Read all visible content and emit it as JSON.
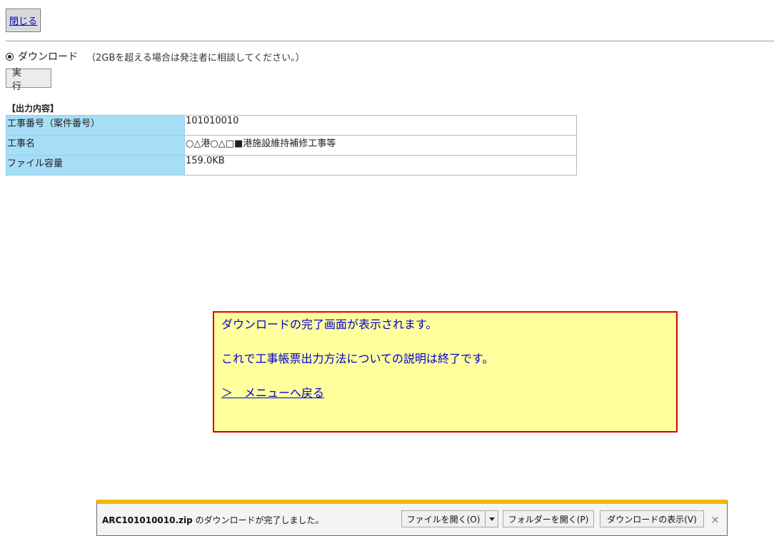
{
  "toolbar": {
    "close_label": "閉じる"
  },
  "download_option": {
    "label": "ダウンロード",
    "note": "（2GBを超える場合は発注者に相談してください。）",
    "execute_label": "実　行"
  },
  "output": {
    "title": "【出力内容】",
    "rows": [
      {
        "label": "工事番号（案件番号）",
        "value": "101010010"
      },
      {
        "label": "工事名",
        "value": "○△港○△□■港施設維持補修工事等"
      },
      {
        "label": "ファイル容量",
        "value": "159.0KB"
      }
    ]
  },
  "callout": {
    "line1": "ダウンロードの完了画面が表示されます。",
    "line2": "これで工事帳票出力方法についての説明は終了です。",
    "link": "＞　メニューへ戻る",
    "colors": {
      "background": "#ffff9d",
      "border": "#e00000",
      "text": "#0000cc"
    }
  },
  "download_bar": {
    "filename": "ARC101010010.zip",
    "message": " のダウンロードが完了しました。",
    "open_file": "ファイルを開く(O)",
    "open_folder": "フォルダーを開く(P)",
    "show_downloads": "ダウンロードの表示(V)",
    "dropdown_icon": "chevron-down-icon",
    "close_icon": "close-icon"
  }
}
